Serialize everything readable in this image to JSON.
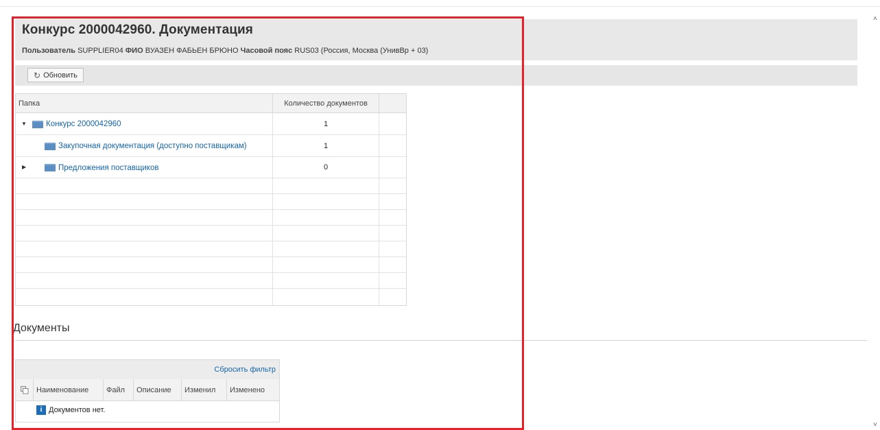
{
  "header": {
    "title": "Конкурс 2000042960. Документация",
    "user_label": "Пользователь",
    "user_value": "SUPPLIER04",
    "fio_label": "ФИО",
    "fio_value": "ВУАЗЕН ФАБЬЕН БРЮНО",
    "tz_label": "Часовой пояс",
    "tz_value": "RUS03 (Россия, Москва (УнивВр + 03)"
  },
  "toolbar": {
    "refresh_label": "Обновить",
    "refresh_icon": "refresh-icon"
  },
  "tree": {
    "col_folder": "Папка",
    "col_count": "Количество документов",
    "rows": [
      {
        "label": "Конкурс 2000042960",
        "count": "1",
        "expanded": true,
        "level": 0
      },
      {
        "label": "Закупочная документация (доступно поставщикам)",
        "count": "1",
        "expanded": null,
        "level": 1
      },
      {
        "label": "Предложения поставщиков",
        "count": "0",
        "expanded": false,
        "level": 0
      }
    ]
  },
  "documents": {
    "title": "Документы",
    "reset_filter": "Сбросить фильтр",
    "columns": [
      "Наименование",
      "Файл",
      "Описание",
      "Изменил",
      "Изменено"
    ],
    "empty_text": "Документов нет."
  },
  "colors": {
    "link": "#1565a8",
    "folder": "#5b8fc4",
    "highlight_frame": "#e8202a"
  }
}
